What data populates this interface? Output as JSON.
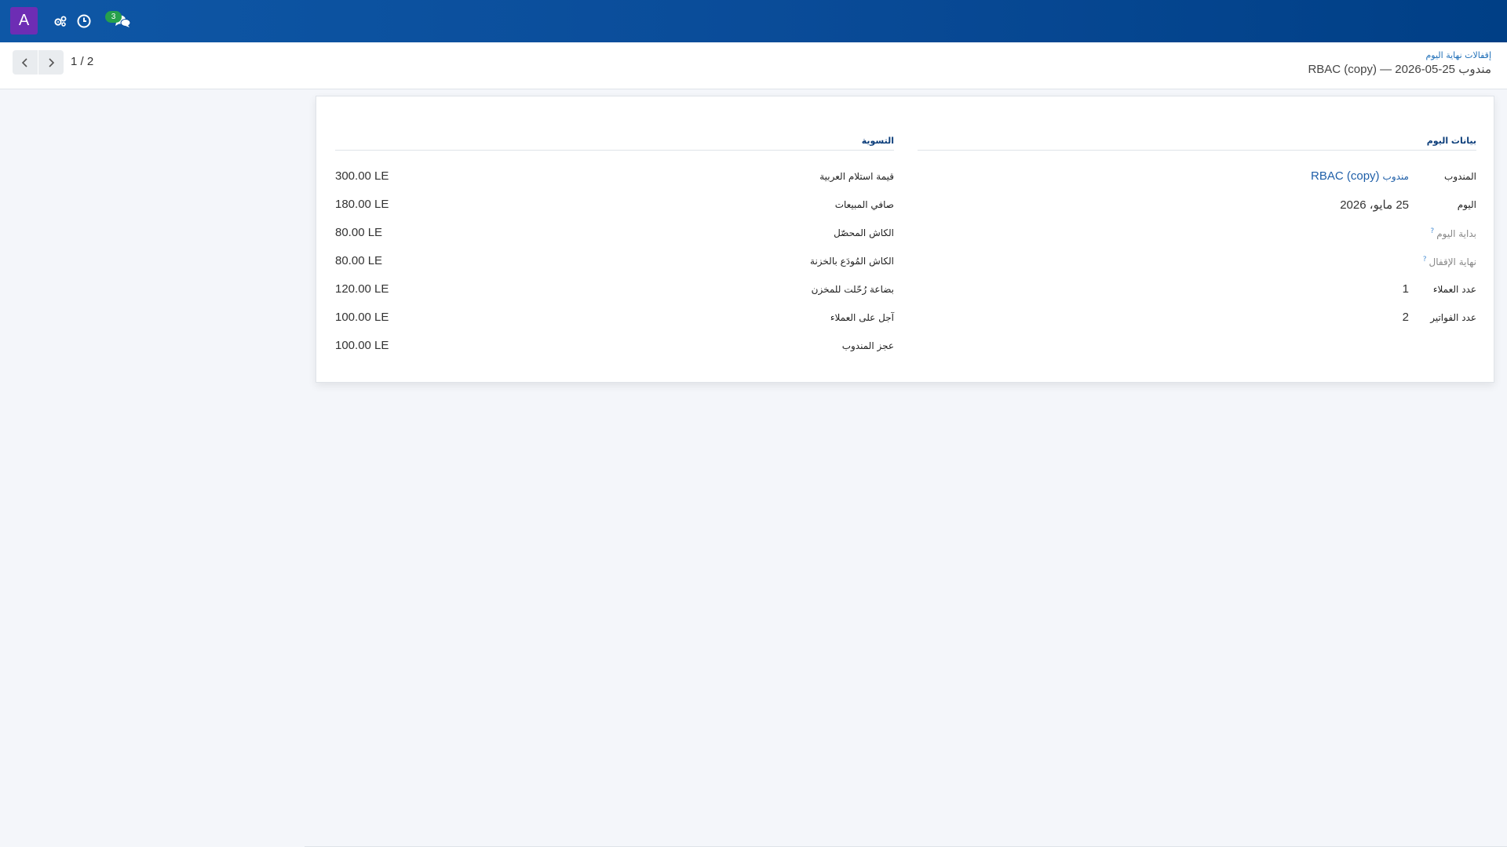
{
  "navbar": {
    "avatar_letter": "A",
    "icons": [
      "activity-settings-icon",
      "clock-icon",
      "chat-icon"
    ],
    "messages_count": "3"
  },
  "controlbar": {
    "breadcrumb": "إقفالات نهاية اليوم",
    "record_title": "مندوب RBAC (copy) — 2026-05-25",
    "pager_value": "1 / 2"
  },
  "sheet": {
    "day_group": {
      "title": "بيانات اليوم",
      "rows": [
        {
          "label": "المندوب",
          "value_prefix": "مندوب",
          "value": "RBAC (copy)"
        },
        {
          "label": "اليوم",
          "value": "25 مايو، 2026"
        },
        {
          "label": "بداية اليوم",
          "help": "?",
          "value": ""
        },
        {
          "label": "نهاية الإقفال",
          "help": "?",
          "value": ""
        },
        {
          "label": "عدد العملاء",
          "value": "1"
        },
        {
          "label": "عدد الفواتير",
          "value": "2"
        }
      ]
    },
    "settlement_group": {
      "title": "التسوية",
      "rows": [
        {
          "label": "قيمة استلام العربية",
          "value": "300.00 LE"
        },
        {
          "label": "صافي المبيعات",
          "value": "180.00 LE"
        },
        {
          "label": "الكاش المحصّل",
          "value": "80.00 LE"
        },
        {
          "label": "الكاش المُودَع بالخزنة",
          "value": "80.00 LE"
        },
        {
          "label": "بضاعة رُحّلت للمخزن",
          "value": "120.00 LE"
        },
        {
          "label": "آجل على العملاء",
          "value": "100.00 LE"
        },
        {
          "label": "عجز المندوب",
          "value": "100.00 LE"
        }
      ]
    }
  }
}
